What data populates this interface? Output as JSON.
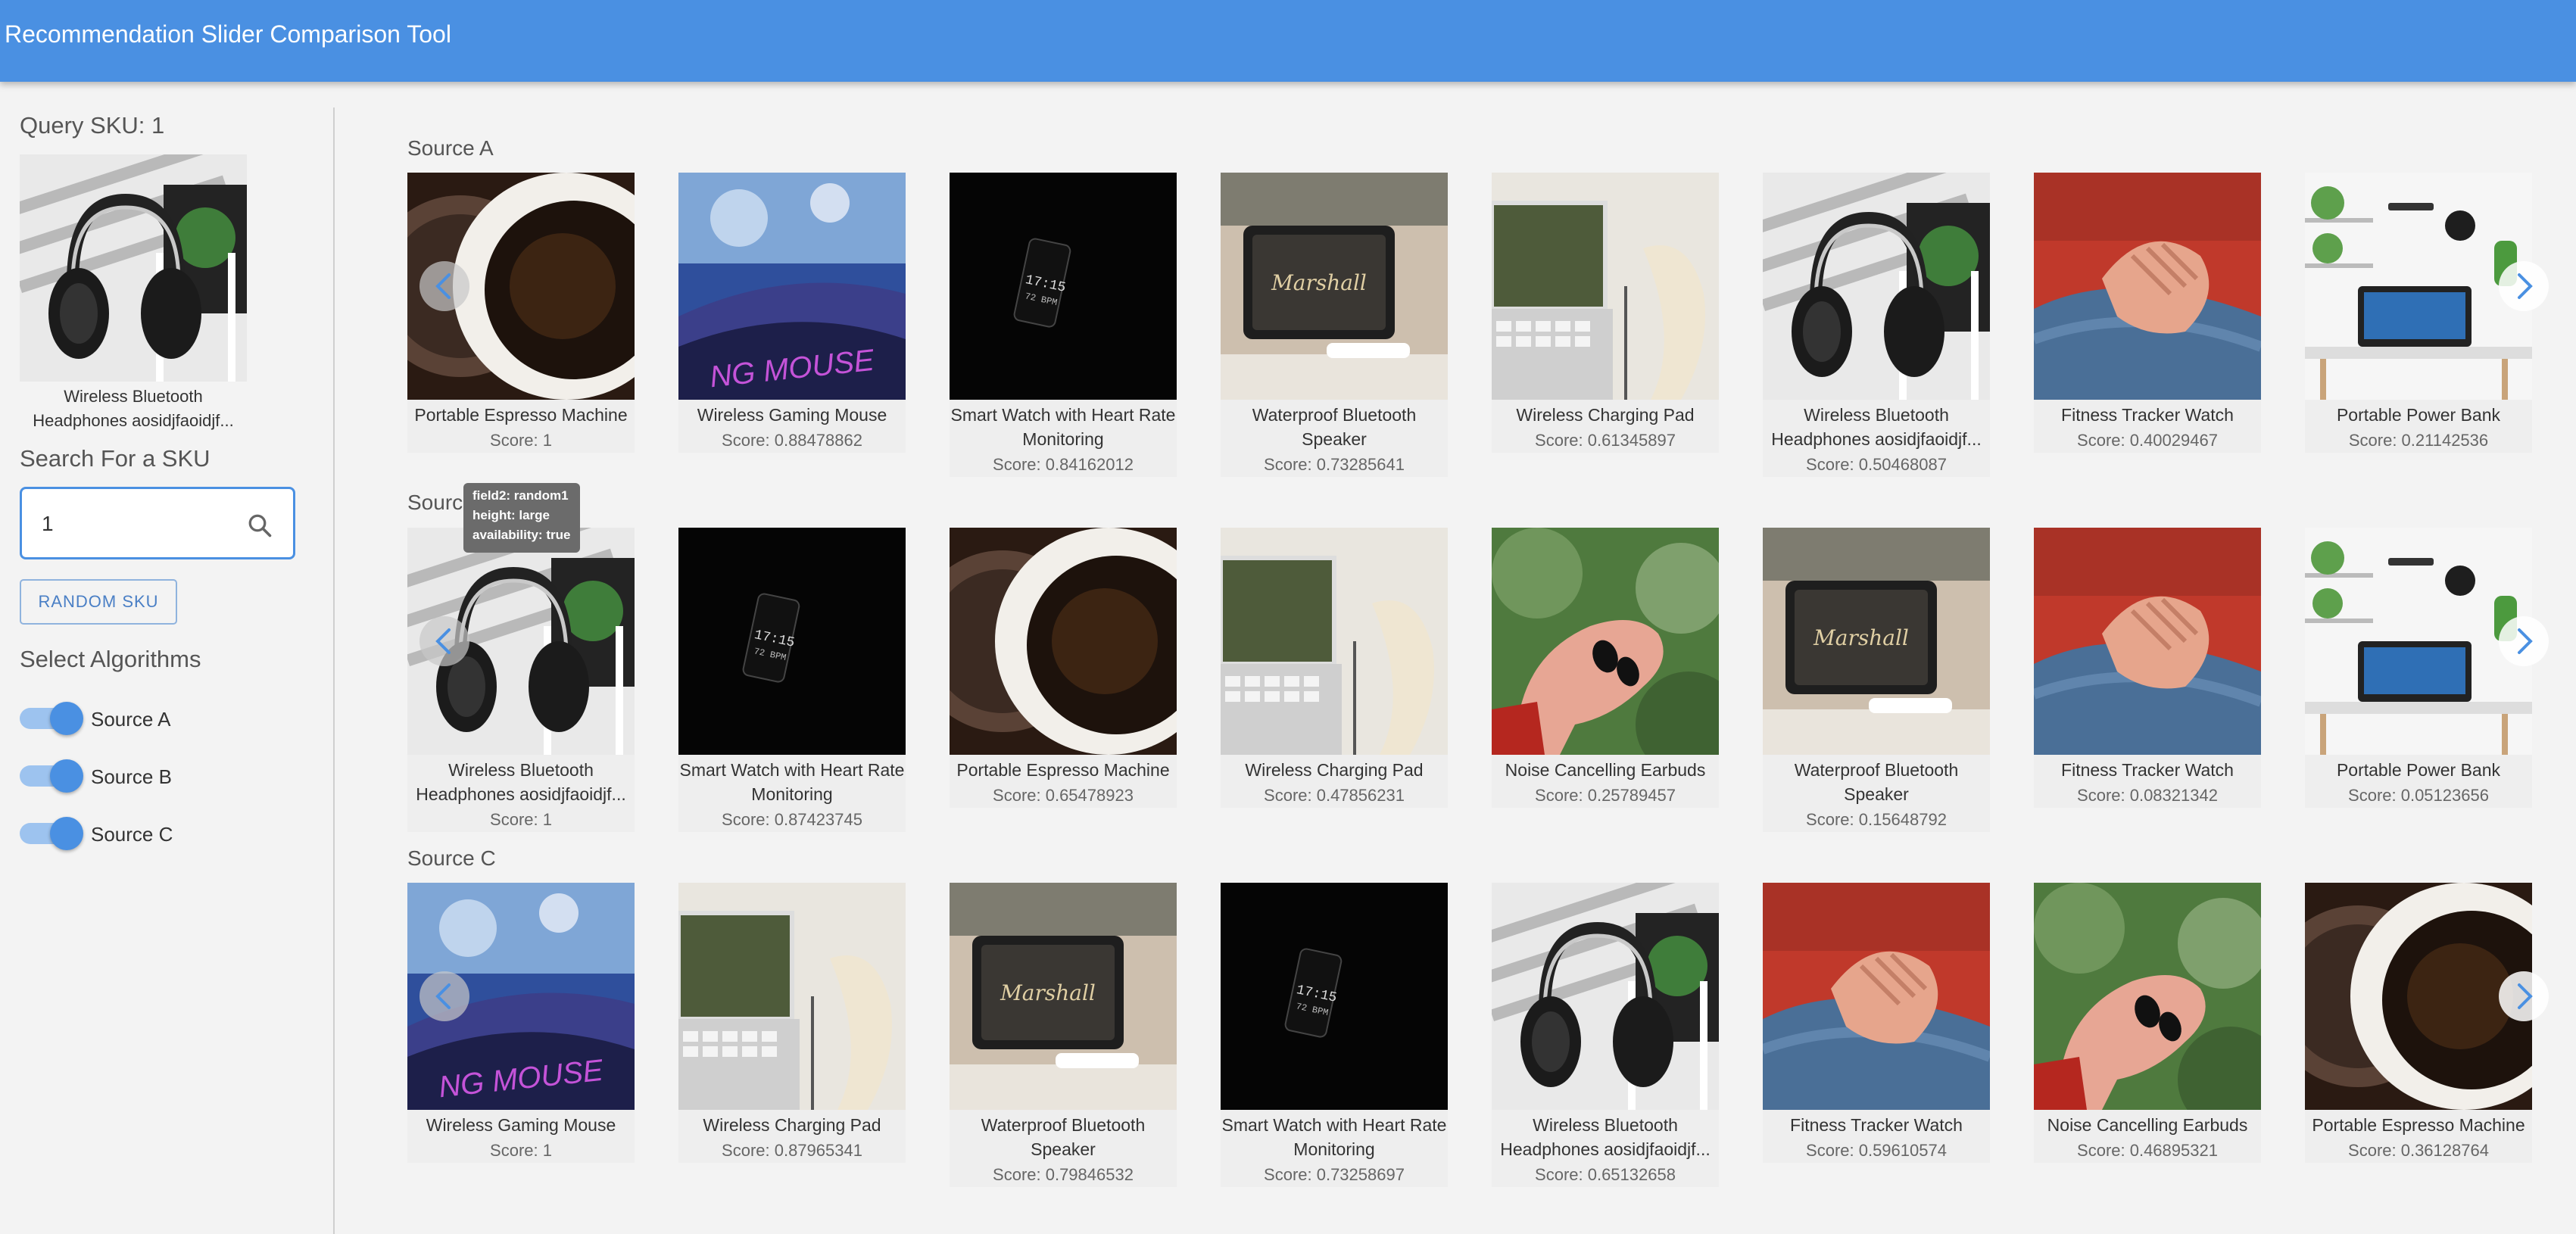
{
  "app": {
    "title": "Recommendation Slider Comparison Tool"
  },
  "sidebar": {
    "query_title": "Query SKU: 1",
    "query_item_name": "Wireless Bluetooth Headphones aosidjfaoidjf...",
    "search_label": "Search For a SKU",
    "search_value": "1",
    "random_button": "RANDOM SKU",
    "algorithms_title": "Select Algorithms",
    "toggles": [
      {
        "label": "Source A",
        "on": true
      },
      {
        "label": "Source B",
        "on": true
      },
      {
        "label": "Source C",
        "on": true
      }
    ]
  },
  "tooltip": {
    "lines": [
      "field2: random1",
      "height: large",
      "availability: true"
    ]
  },
  "rows": [
    {
      "label": "Source A",
      "items": [
        {
          "name": "Portable Espresso Machine",
          "score": "Score: 1",
          "img": "coffee"
        },
        {
          "name": "Wireless Gaming Mouse",
          "score": "Score: 0.88478862",
          "img": "mouse"
        },
        {
          "name": "Smart Watch with Heart Rate Monitoring",
          "score": "Score: 0.84162012",
          "img": "watch"
        },
        {
          "name": "Waterproof Bluetooth Speaker",
          "score": "Score: 0.73285641",
          "img": "speaker"
        },
        {
          "name": "Wireless Charging Pad",
          "score": "Score: 0.61345897",
          "img": "charger"
        },
        {
          "name": "Wireless Bluetooth Headphones aosidjfaoidjf...",
          "score": "Score: 0.50468087",
          "img": "headphones"
        },
        {
          "name": "Fitness Tracker Watch",
          "score": "Score: 0.40029467",
          "img": "hand"
        },
        {
          "name": "Portable Power Bank",
          "score": "Score: 0.21142536",
          "img": "desk"
        }
      ]
    },
    {
      "label": "Source B",
      "items": [
        {
          "name": "Wireless Bluetooth Headphones aosidjfaoidjf...",
          "score": "Score: 1",
          "img": "headphones"
        },
        {
          "name": "Smart Watch with Heart Rate Monitoring",
          "score": "Score: 0.87423745",
          "img": "watch"
        },
        {
          "name": "Portable Espresso Machine",
          "score": "Score: 0.65478923",
          "img": "coffee"
        },
        {
          "name": "Wireless Charging Pad",
          "score": "Score: 0.47856231",
          "img": "charger"
        },
        {
          "name": "Noise Cancelling Earbuds",
          "score": "Score: 0.25789457",
          "img": "earbuds"
        },
        {
          "name": "Waterproof Bluetooth Speaker",
          "score": "Score: 0.15648792",
          "img": "speaker"
        },
        {
          "name": "Fitness Tracker Watch",
          "score": "Score: 0.08321342",
          "img": "hand"
        },
        {
          "name": "Portable Power Bank",
          "score": "Score: 0.05123656",
          "img": "desk"
        }
      ]
    },
    {
      "label": "Source C",
      "items": [
        {
          "name": "Wireless Gaming Mouse",
          "score": "Score: 1",
          "img": "mouse"
        },
        {
          "name": "Wireless Charging Pad",
          "score": "Score: 0.87965341",
          "img": "charger"
        },
        {
          "name": "Waterproof Bluetooth Speaker",
          "score": "Score: 0.79846532",
          "img": "speaker"
        },
        {
          "name": "Smart Watch with Heart Rate Monitoring",
          "score": "Score: 0.73258697",
          "img": "watch"
        },
        {
          "name": "Wireless Bluetooth Headphones aosidjfaoidjf...",
          "score": "Score: 0.65132658",
          "img": "headphones"
        },
        {
          "name": "Fitness Tracker Watch",
          "score": "Score: 0.59610574",
          "img": "hand"
        },
        {
          "name": "Noise Cancelling Earbuds",
          "score": "Score: 0.46895321",
          "img": "earbuds"
        },
        {
          "name": "Portable Espresso Machine",
          "score": "Score: 0.36128764",
          "img": "coffee"
        }
      ]
    }
  ]
}
